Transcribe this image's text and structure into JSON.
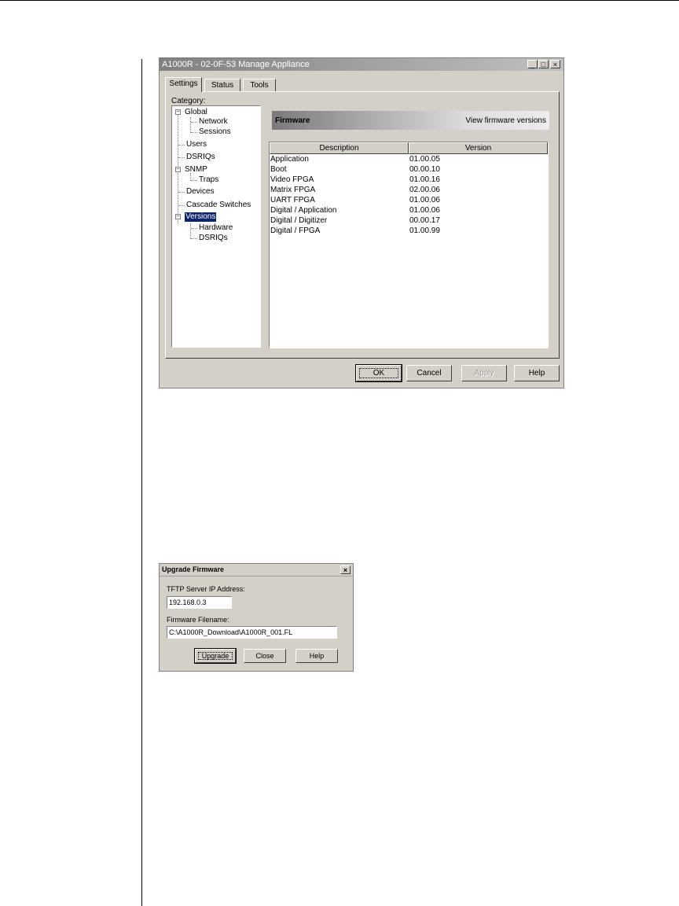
{
  "manage_window": {
    "title": "A1000R - 02-0F-53 Manage Appliance",
    "controls": {
      "minimize": "_",
      "maximize": "□",
      "close": "×"
    },
    "tabs": [
      {
        "label": "Settings",
        "active": true
      },
      {
        "label": "Status"
      },
      {
        "label": "Tools"
      }
    ],
    "category_label": "Category:",
    "tree": {
      "global": "Global",
      "network": "Network",
      "sessions": "Sessions",
      "users": "Users",
      "dsriqs": "DSRIQs",
      "snmp": "SNMP",
      "traps": "Traps",
      "devices": "Devices",
      "cascade": "Cascade Switches",
      "versions": "Versions",
      "hardware": "Hardware",
      "dsriqs_sub": "DSRIQs",
      "expander": "−"
    },
    "section": {
      "title": "Firmware",
      "subtitle": "View firmware versions"
    },
    "table": {
      "headers": [
        "Description",
        "Version"
      ],
      "rows": [
        [
          "Application",
          "01.00.05"
        ],
        [
          "Boot",
          "00.00.10"
        ],
        [
          "Video FPGA",
          "01.00.16"
        ],
        [
          "Matrix FPGA",
          "02.00.06"
        ],
        [
          "UART FPGA",
          "01.00.06"
        ],
        [
          "Digital / Application",
          "01.00.06"
        ],
        [
          "Digital / Digitizer",
          "00.00.17"
        ],
        [
          "Digital / FPGA",
          "01.00.99"
        ]
      ]
    },
    "buttons": {
      "ok": "OK",
      "cancel": "Cancel",
      "apply": "Apply",
      "help": "Help"
    }
  },
  "upgrade_dialog": {
    "title": "Upgrade Firmware",
    "close": "×",
    "ip_label": "TFTP Server IP Address:",
    "ip_value": "192.168.0.3",
    "file_label": "Firmware Filename:",
    "file_value": "C:\\A1000R_Download\\A1000R_001.FL",
    "buttons": {
      "upgrade": "Upgrade",
      "close": "Close",
      "help": "Help"
    }
  }
}
